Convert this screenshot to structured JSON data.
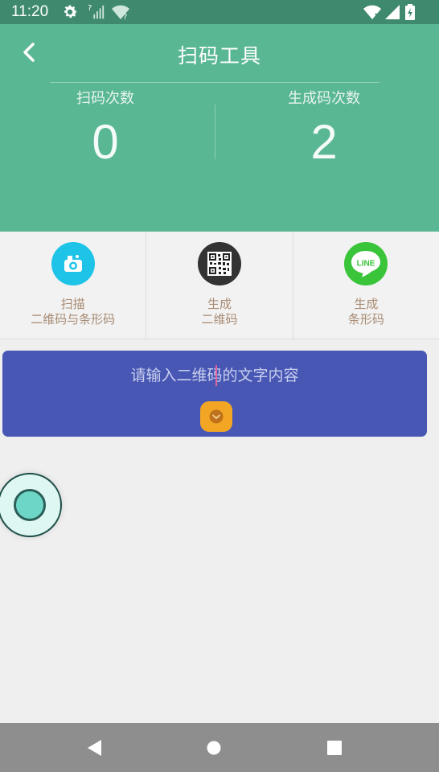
{
  "status_bar": {
    "time": "11:20",
    "icons": [
      "gear-icon",
      "signal-unknown-icon",
      "wifi-question-icon",
      "wifi-off-icon",
      "cell-signal-icon",
      "battery-charging-icon"
    ],
    "color": "#3f8a6e"
  },
  "header": {
    "title": "扫码工具",
    "back_icon": "chevron-left-icon",
    "color": "#5ab794",
    "stats": [
      {
        "label": "扫码次数",
        "value": "0"
      },
      {
        "label": "生成码次数",
        "value": "2"
      }
    ]
  },
  "tools": [
    {
      "icon": "camera-scan-icon",
      "icon_color": "#1ec3e8",
      "line1": "扫描",
      "line2": "二维码与条形码"
    },
    {
      "icon": "qr-code-icon",
      "icon_color": "#333333",
      "line1": "生成",
      "line2": "二维码"
    },
    {
      "icon": "line-logo-icon",
      "icon_color": "#3ac43a",
      "line1": "生成",
      "line2": "条形码"
    }
  ],
  "input_card": {
    "placeholder": "请输入二维码的文字内容",
    "color": "#4757b3",
    "expand_icon": "chevron-down-circle-icon",
    "expand_color": "#f2a624"
  },
  "floating_ball": {
    "icon": "floating-assist-ball-icon"
  },
  "nav_bar": {
    "buttons": [
      "back-triangle-icon",
      "home-circle-icon",
      "recents-square-icon"
    ]
  }
}
